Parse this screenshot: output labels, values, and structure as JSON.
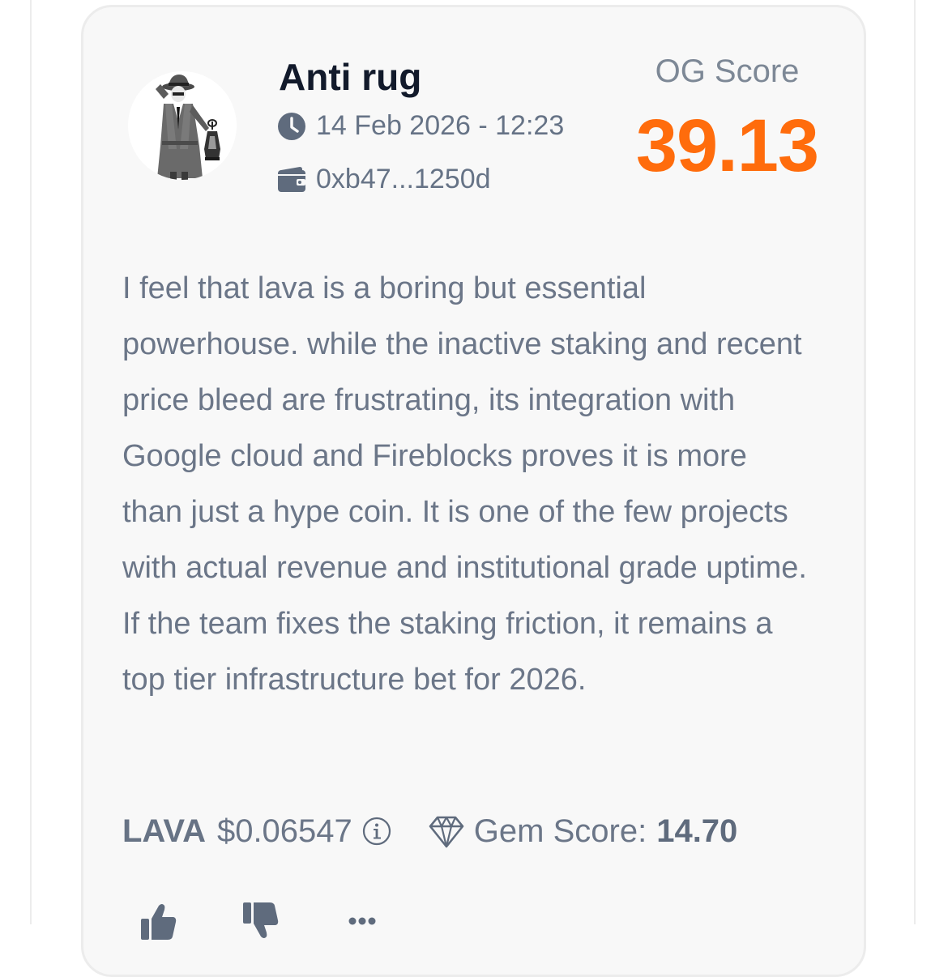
{
  "post": {
    "author": "Anti rug",
    "date": "14 Feb 2026 - 12:23",
    "wallet": "0xb47...1250d",
    "og_score_label": "OG Score",
    "og_score_value": "39.13",
    "body": "I feel that lava is a boring but essential powerhouse. while the inactive staking and recent price bleed are frustrating, its integration with Google cloud and Fireblocks proves it is more than just a hype coin. It is one of the few projects with actual revenue and institutional grade uptime. If the team fixes the staking friction, it remains a top tier infrastructure bet for 2026."
  },
  "token": {
    "symbol": "LAVA",
    "price": "$0.06547",
    "gem_score_label": "Gem Score:",
    "gem_score_value": "14.70"
  },
  "icons": {
    "date": "clock-icon",
    "wallet": "wallet-icon",
    "price_info": "info-icon",
    "gem": "diamond-icon",
    "like": "thumbs-up-icon",
    "dislike": "thumbs-down-icon",
    "more": "more-icon"
  },
  "colors": {
    "score_accent": "#ff6c0c",
    "text_primary": "#121a2b",
    "text_muted": "#6b7688",
    "card_background": "#f8f8f8",
    "card_border": "#ececec"
  }
}
